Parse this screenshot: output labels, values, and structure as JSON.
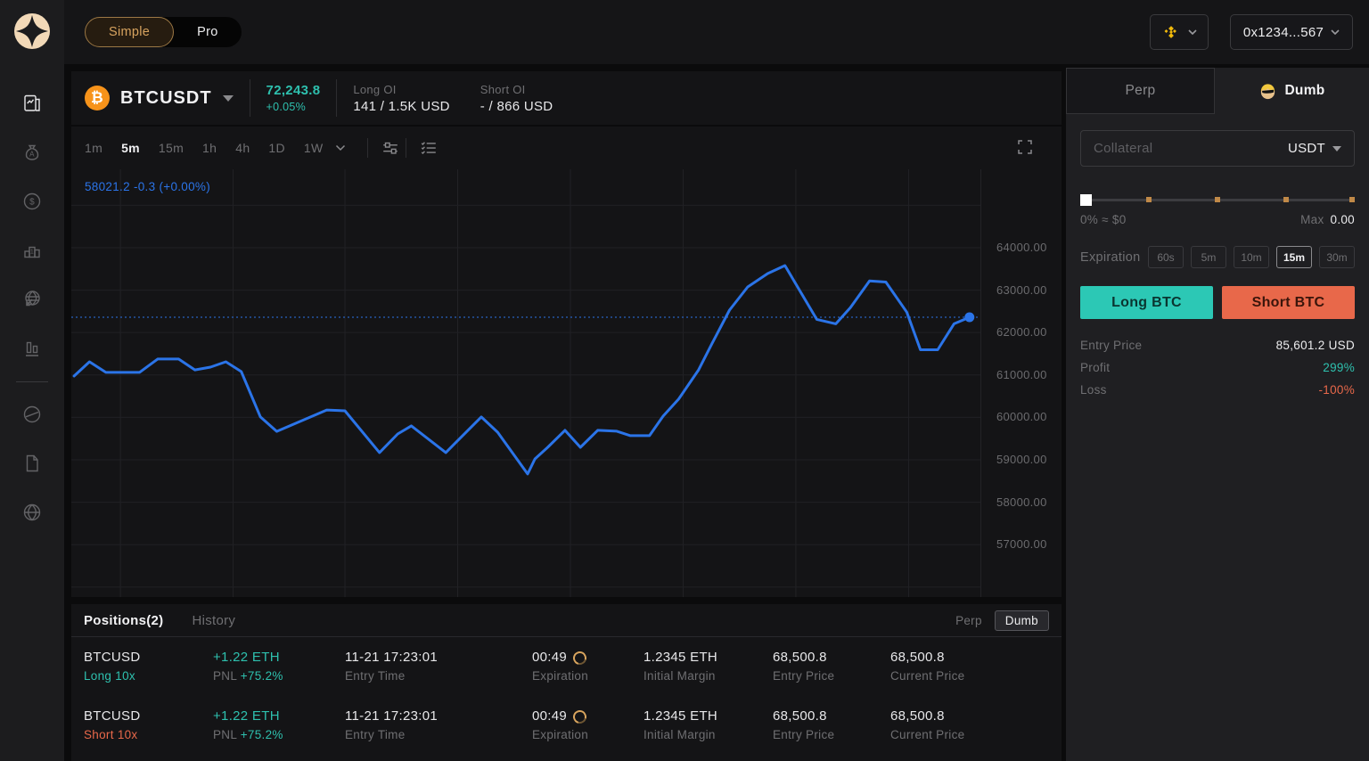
{
  "topbar": {
    "mode_simple": "Simple",
    "mode_pro": "Pro",
    "wallet_address": "0x1234...567",
    "chain_icon": "bnb-chain-icon"
  },
  "sidebar": {
    "items": [
      {
        "icon": "trade-chart-icon",
        "active": true
      },
      {
        "icon": "money-bag-icon",
        "active": false
      },
      {
        "icon": "dollar-coin-icon",
        "active": false
      },
      {
        "icon": "leaderboard-icon",
        "active": false
      },
      {
        "icon": "globe-arrow-icon",
        "active": false
      },
      {
        "icon": "stats-bars-icon",
        "active": false
      },
      {
        "icon": "circle-slash-icon",
        "active": false
      },
      {
        "icon": "document-icon",
        "active": false
      },
      {
        "icon": "globe-icon",
        "active": false
      }
    ]
  },
  "market_header": {
    "pair": "BTCUSDT",
    "price": "72,243.8",
    "change": "+0.05%",
    "long_oi_label": "Long OI",
    "long_oi_value": "141 / 1.5K USD",
    "short_oi_label": "Short OI",
    "short_oi_value": "- / 866 USD"
  },
  "chart": {
    "timeframes": [
      "1m",
      "5m",
      "15m",
      "1h",
      "4h",
      "1D",
      "1W"
    ],
    "active_timeframe": "5m"
  },
  "chart_data": {
    "type": "line",
    "symbol": "BTCUSDT",
    "timeframe": "5m",
    "legend": "58021.2 -0.3 (+0.00%)",
    "line_color": "#2b74e8",
    "ylim": [
      55765,
      65848
    ],
    "y_ticks": [
      64000,
      63000,
      62000,
      61000,
      60000,
      59000,
      58000,
      57000
    ],
    "grid_y": [
      65000,
      64000,
      63000,
      62000,
      61000,
      60000,
      59000,
      58000,
      57000,
      56000
    ],
    "grid_x_fractions": [
      0.054,
      0.178,
      0.301,
      0.425,
      0.549,
      0.673,
      0.797,
      0.921
    ],
    "current_price": 62360,
    "points": [
      [
        0.003,
        60975
      ],
      [
        0.02,
        61310
      ],
      [
        0.038,
        61060
      ],
      [
        0.075,
        61060
      ],
      [
        0.095,
        61375
      ],
      [
        0.118,
        61375
      ],
      [
        0.136,
        61120
      ],
      [
        0.153,
        61185
      ],
      [
        0.17,
        61310
      ],
      [
        0.187,
        61080
      ],
      [
        0.208,
        60010
      ],
      [
        0.226,
        59670
      ],
      [
        0.281,
        60175
      ],
      [
        0.301,
        60155
      ],
      [
        0.339,
        59170
      ],
      [
        0.359,
        59610
      ],
      [
        0.374,
        59800
      ],
      [
        0.412,
        59170
      ],
      [
        0.451,
        60010
      ],
      [
        0.469,
        59650
      ],
      [
        0.502,
        58665
      ],
      [
        0.51,
        59020
      ],
      [
        0.524,
        59295
      ],
      [
        0.543,
        59695
      ],
      [
        0.56,
        59295
      ],
      [
        0.579,
        59695
      ],
      [
        0.6,
        59675
      ],
      [
        0.615,
        59570
      ],
      [
        0.636,
        59570
      ],
      [
        0.651,
        60030
      ],
      [
        0.668,
        60430
      ],
      [
        0.69,
        61120
      ],
      [
        0.705,
        61750
      ],
      [
        0.724,
        62530
      ],
      [
        0.744,
        63075
      ],
      [
        0.766,
        63390
      ],
      [
        0.785,
        63580
      ],
      [
        0.82,
        62310
      ],
      [
        0.841,
        62205
      ],
      [
        0.857,
        62585
      ],
      [
        0.878,
        63215
      ],
      [
        0.896,
        63190
      ],
      [
        0.919,
        62480
      ],
      [
        0.934,
        61595
      ],
      [
        0.953,
        61595
      ],
      [
        0.971,
        62205
      ],
      [
        0.988,
        62360
      ]
    ]
  },
  "trade_panel": {
    "tab_perp": "Perp",
    "tab_dumb": "Dumb",
    "active_tab": "Dumb",
    "collateral_placeholder": "Collateral",
    "collateral_currency": "USDT",
    "slider": {
      "left_label": "0% ≈ $0",
      "max_label": "Max",
      "max_value": "0.00",
      "tick_fractions": [
        0.25,
        0.5,
        0.75,
        0.99
      ]
    },
    "expiration_label": "Expiration",
    "expiration_options": [
      "60s",
      "5m",
      "10m",
      "15m",
      "30m"
    ],
    "active_expiration": "15m",
    "long_button": "Long BTC",
    "short_button": "Short BTC",
    "entry_price_label": "Entry Price",
    "entry_price_value": "85,601.2 USD",
    "profit_label": "Profit",
    "profit_value": "299%",
    "loss_label": "Loss",
    "loss_value": "-100%"
  },
  "positions": {
    "tab_positions": "Positions(2)",
    "tab_history": "History",
    "filter_perp": "Perp",
    "filter_dumb": "Dumb",
    "rows": [
      {
        "pair": "BTCUSD",
        "side": "Long 10x",
        "size": "+1.22 ETH",
        "pnl_label": "PNL",
        "pnl_value": "+75.2%",
        "entry_time": "11-21 17:23:01",
        "entry_time_label": "Entry Time",
        "expiration": "00:49",
        "expiration_label": "Expiration",
        "initial_margin": "1.2345 ETH",
        "initial_margin_label": "Initial Margin",
        "entry_price": "68,500.8",
        "entry_price_label": "Entry Price",
        "current_price": "68,500.8",
        "current_price_label": "Current Price"
      },
      {
        "pair": "BTCUSD",
        "side": "Short 10x",
        "size": "+1.22 ETH",
        "pnl_label": "PNL",
        "pnl_value": "+75.2%",
        "entry_time": "11-21 17:23:01",
        "entry_time_label": "Entry Time",
        "expiration": "00:49",
        "expiration_label": "Expiration",
        "initial_margin": "1.2345 ETH",
        "initial_margin_label": "Initial Margin",
        "entry_price": "68,500.8",
        "entry_price_label": "Entry Price",
        "current_price": "68,500.8",
        "current_price_label": "Current Price"
      }
    ]
  },
  "colors": {
    "accent_teal": "#2ec0ae",
    "accent_coral": "#e8684a",
    "chart_blue": "#2b74e8",
    "gold": "#d7a35f",
    "bnb_yellow": "#f0b90b",
    "bitcoin_orange": "#f7931a"
  }
}
